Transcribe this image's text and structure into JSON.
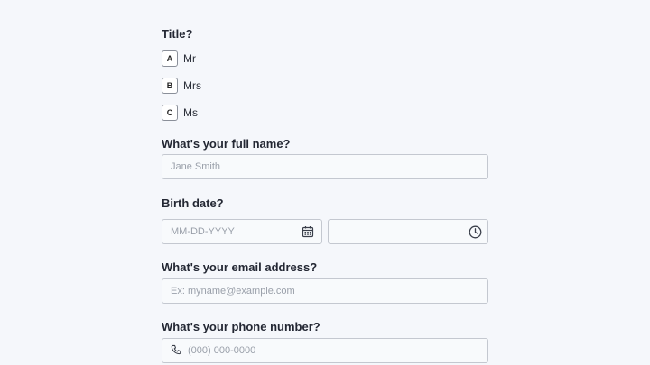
{
  "title_question": {
    "label": "Title?",
    "options": [
      {
        "key": "A",
        "label": "Mr"
      },
      {
        "key": "B",
        "label": "Mrs"
      },
      {
        "key": "C",
        "label": "Ms"
      }
    ]
  },
  "full_name": {
    "label": "What's your full name?",
    "placeholder": "Jane Smith",
    "value": ""
  },
  "birth_date": {
    "label": "Birth date?",
    "date_placeholder": "MM-DD-YYYY",
    "date_value": "",
    "time_value": "",
    "date_icon": "calendar-icon",
    "time_icon": "clock-icon"
  },
  "email": {
    "label": "What's your email address?",
    "placeholder": "Ex: myname@example.com",
    "value": ""
  },
  "phone": {
    "label": "What's your phone number?",
    "placeholder": "(000) 000-0000",
    "value": "",
    "icon": "phone-icon"
  },
  "colors": {
    "background": "#f5f7fb",
    "field_border": "#c4c8d0",
    "placeholder": "#9aa0aa",
    "text": "#232733"
  }
}
